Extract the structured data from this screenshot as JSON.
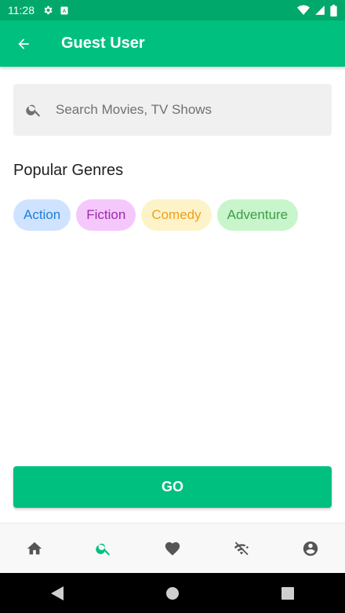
{
  "status_bar": {
    "time": "11:28"
  },
  "app_bar": {
    "title": "Guest User"
  },
  "search": {
    "placeholder": "Search Movies, TV Shows"
  },
  "genres": {
    "title": "Popular Genres",
    "items": [
      {
        "label": "Action",
        "bg": "#cfe3ff",
        "color": "#1e7fd8"
      },
      {
        "label": "Fiction",
        "bg": "#f5c8fb",
        "color": "#9c27b0"
      },
      {
        "label": "Comedy",
        "bg": "#fdf3c8",
        "color": "#f0a020"
      },
      {
        "label": "Adventure",
        "bg": "#c8f5cc",
        "color": "#3f9b47"
      }
    ]
  },
  "go_button": {
    "label": "GO"
  },
  "bottom_nav": {
    "items": [
      {
        "icon": "home-icon",
        "active": false
      },
      {
        "icon": "search-icon",
        "active": true
      },
      {
        "icon": "heart-icon",
        "active": false
      },
      {
        "icon": "wifi-off-icon",
        "active": false
      },
      {
        "icon": "account-icon",
        "active": false
      }
    ]
  },
  "colors": {
    "primary": "#00c07f",
    "status_bar": "#00a86b",
    "nav_active": "#00c07f",
    "nav_inactive": "#555555"
  }
}
